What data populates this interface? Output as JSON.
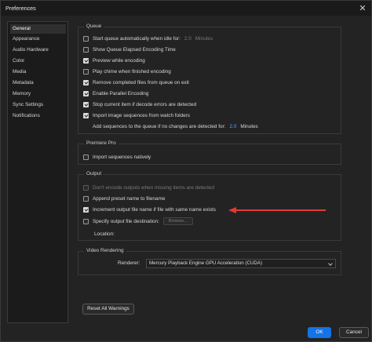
{
  "window": {
    "title": "Preferences"
  },
  "sidebar": {
    "items": [
      {
        "label": "General",
        "active": true
      },
      {
        "label": "Appearance"
      },
      {
        "label": "Audio Hardware"
      },
      {
        "label": "Color"
      },
      {
        "label": "Media"
      },
      {
        "label": "Metadata"
      },
      {
        "label": "Memory"
      },
      {
        "label": "Sync Settings"
      },
      {
        "label": "Notifications"
      }
    ]
  },
  "queue": {
    "title": "Queue",
    "start_when_idle": {
      "label": "Start queue automatically when idle for:",
      "value": "2.0",
      "unit": "Minutes"
    },
    "show_elapsed": "Show Queue Elapsed Encoding Time",
    "preview": "Preview while encoding",
    "chime": "Play chime when finished encoding",
    "remove_completed": "Remove completed files from queue on exit",
    "parallel": "Enable Parallel Encoding",
    "stop_on_error": "Stop current item if decode errors are detected",
    "import_from_watch": "Import image sequences from watch folders",
    "add_sequences": {
      "label": "Add sequences to the queue if no changes are detected for:",
      "value": "2.0",
      "unit": "Minutes"
    }
  },
  "premiere": {
    "title": "Premiere Pro",
    "import_natively": "Import sequences natively"
  },
  "output": {
    "title": "Output",
    "dont_encode": "Don't encode outputs when missing items are detected",
    "append_preset": "Append preset name to filename",
    "increment_name": "Increment output file name if file with same name exists",
    "specify_dest": "Specify output file destination:",
    "browse": "Browse...",
    "location": "Location:"
  },
  "video_rendering": {
    "title": "Video Rendering",
    "renderer_label": "Renderer:",
    "renderer_value": "Mercury Playback Engine GPU Acceleration (CUDA)"
  },
  "buttons": {
    "reset": "Reset All Warnings",
    "ok": "OK",
    "cancel": "Cancel"
  },
  "colors": {
    "accent": "#1473e6",
    "link": "#5ba5ff",
    "arrow": "#e53935"
  }
}
